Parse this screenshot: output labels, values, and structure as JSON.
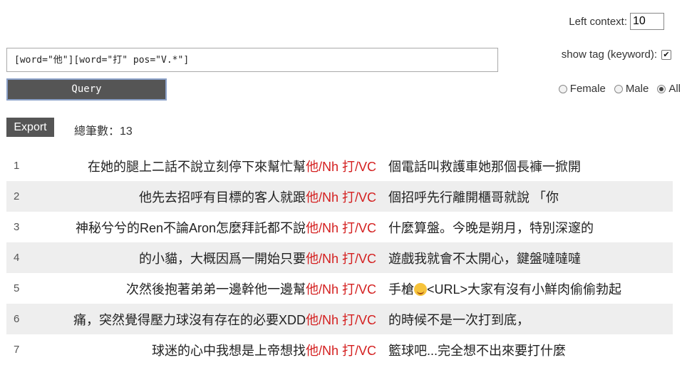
{
  "controls": {
    "left_context_label": "Left context:",
    "left_context_value": "10",
    "query_text": "[word=\"他\"][word=\"打\" pos=\"V.*\"]",
    "query_button": "Query",
    "show_tag_label": "show tag (keyword):",
    "show_tag_checked": true,
    "gender_options": [
      "Female",
      "Male",
      "All"
    ],
    "gender_selected": "All",
    "export_button": "Export",
    "total_label": "總筆數：13"
  },
  "keyword_color": "#d42020",
  "rows": [
    {
      "index": "1",
      "left": "在她的腿上二話不說立刻停下來幫忙幫",
      "kw1": "他/Nh",
      "kw2": "打/VC",
      "right": "個電話叫救護車她那個長褲一掀開"
    },
    {
      "index": "2",
      "left": "他先去招呼有目標的客人就跟",
      "kw1": "他/Nh",
      "kw2": "打/VC",
      "right": "個招呼先行離開櫃哥就說 「你"
    },
    {
      "index": "3",
      "left": "神秘兮兮的Ren不論Aron怎麼拜託都不說",
      "kw1": "他/Nh",
      "kw2": "打/VC",
      "right": "什麼算盤。今晚是朔月，特別深邃的"
    },
    {
      "index": "4",
      "left": "的小貓，大概因爲一開始只要",
      "kw1": "他/Nh",
      "kw2": "打/VC",
      "right": "遊戲我就會不太開心，鍵盤噠噠噠"
    },
    {
      "index": "5",
      "left": "次然後抱著弟弟一邊幹他一邊幫",
      "kw1": "他/Nh",
      "kw2": "打/VC",
      "right_pre": "手槍",
      "right_emoji": "yum-face-icon",
      "right": "<URL>大家有沒有小鮮肉偷偷勃起"
    },
    {
      "index": "6",
      "left": "痛，突然覺得壓力球沒有存在的必要XDD",
      "kw1": "他/Nh",
      "kw2": "打/VC",
      "right": "的時候不是一次打到底，"
    },
    {
      "index": "7",
      "left": "球迷的心中我想是上帝想找",
      "kw1": "他/Nh",
      "kw2": "打/VC",
      "right": "籃球吧...完全想不出來要打什麼"
    }
  ]
}
